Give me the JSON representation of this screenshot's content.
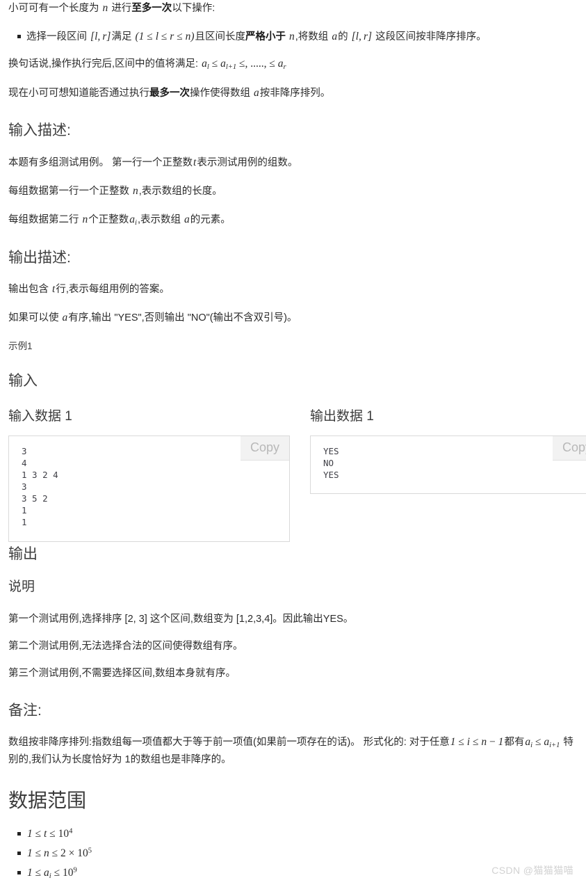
{
  "problem": {
    "intro_prefix": "小可可有一个长度为",
    "intro_var_n": "n",
    "intro_mid": "进行",
    "intro_bold": "至多一次",
    "intro_suffix": "以下操作:",
    "bullet": {
      "p1": "选择一段区间",
      "m1": "[l, r]",
      "p2": "满足",
      "m2": "(1 ≤ l ≤ r ≤ n)",
      "p3": "且区间长度",
      "bold": "严格小于",
      "m3": "n",
      "p4": ",将数组",
      "m4": "a",
      "p5": "的",
      "m5": "[l, r]",
      "p6": "这段区间按非降序排序。"
    },
    "restate_prefix": "换句话说,操作执行完后,区间中的值将满足:",
    "restate_math": "a_l ≤ a_{l+1} ≤, ....., ≤ a_r",
    "goal_p1": "现在小可可想知道能否通过执行",
    "goal_bold": "最多一次",
    "goal_p2": "操作使得数组",
    "goal_m": "a",
    "goal_p3": "按非降序排列。"
  },
  "input_desc": {
    "heading": "输入描述:",
    "line1_a": "本题有多组测试用例。 第一行一个正整数",
    "line1_m": "t",
    "line1_b": "表示测试用例的组数。",
    "line2_a": "每组数据第一行一个正整数",
    "line2_m": "n",
    "line2_b": ",表示数组的长度。",
    "line3_a": "每组数据第二行",
    "line3_m1": "n",
    "line3_b": "个正整数",
    "line3_m2": "a_i",
    "line3_c": ",表示数组",
    "line3_m3": "a",
    "line3_d": "的元素。"
  },
  "output_desc": {
    "heading": "输出描述:",
    "line1_a": "输出包含",
    "line1_m": "t",
    "line1_b": "行,表示每组用例的答案。",
    "line2_a": "如果可以使",
    "line2_m": "a",
    "line2_b": "有序,输出 \"YES\",否则输出 \"NO\"(输出不含双引号)。"
  },
  "example": {
    "label": "示例1",
    "input_heading": "输入",
    "output_heading": "输出",
    "input_data_title": "输入数据 1",
    "output_data_title": "输出数据 1",
    "copy_label": "Copy",
    "input_data": "3\n4\n1 3 2 4\n3\n3 5 2\n1\n1",
    "output_data": "YES\nNO\nYES"
  },
  "explain": {
    "heading": "说明",
    "line1": "第一个测试用例,选择排序 [2, 3] 这个区间,数组变为 [1,2,3,4]。因此输出YES。",
    "line2": "第二个测试用例,无法选择合法的区间使得数组有序。",
    "line3": "第三个测试用例,不需要选择区间,数组本身就有序。"
  },
  "remark": {
    "heading": "备注:",
    "text_a": "数组按非降序排列:指数组每一项值都大于等于前一项值(如果前一项存在的话)。 形式化的: 对于任意",
    "math_a": "1 ≤ i ≤ n − 1",
    "text_b": "都有",
    "math_b": "a_i ≤ a_{i+1}",
    "text_c": "特别的,我们认为长度恰好为 1的数组也是非降序的。"
  },
  "range": {
    "heading": "数据范围",
    "items": [
      {
        "lo": "1",
        "var": "t",
        "hi": "10",
        "exp": "4",
        "mul": ""
      },
      {
        "lo": "1",
        "var": "n",
        "hi": "10",
        "exp": "5",
        "mul": "2 ×"
      },
      {
        "lo": "1",
        "var": "a",
        "sub": "i",
        "hi": "10",
        "exp": "9",
        "mul": ""
      }
    ]
  },
  "watermark": "CSDN @猫猫猫喵",
  "colors": {
    "text": "#2b2b2b",
    "heading": "#3c3c3c",
    "border": "#d9d9d9",
    "copy_bg": "#f2f2f2",
    "copy_text": "#b8b8b8",
    "code_text": "#3f3f46",
    "watermark": "#d2d2d2"
  }
}
